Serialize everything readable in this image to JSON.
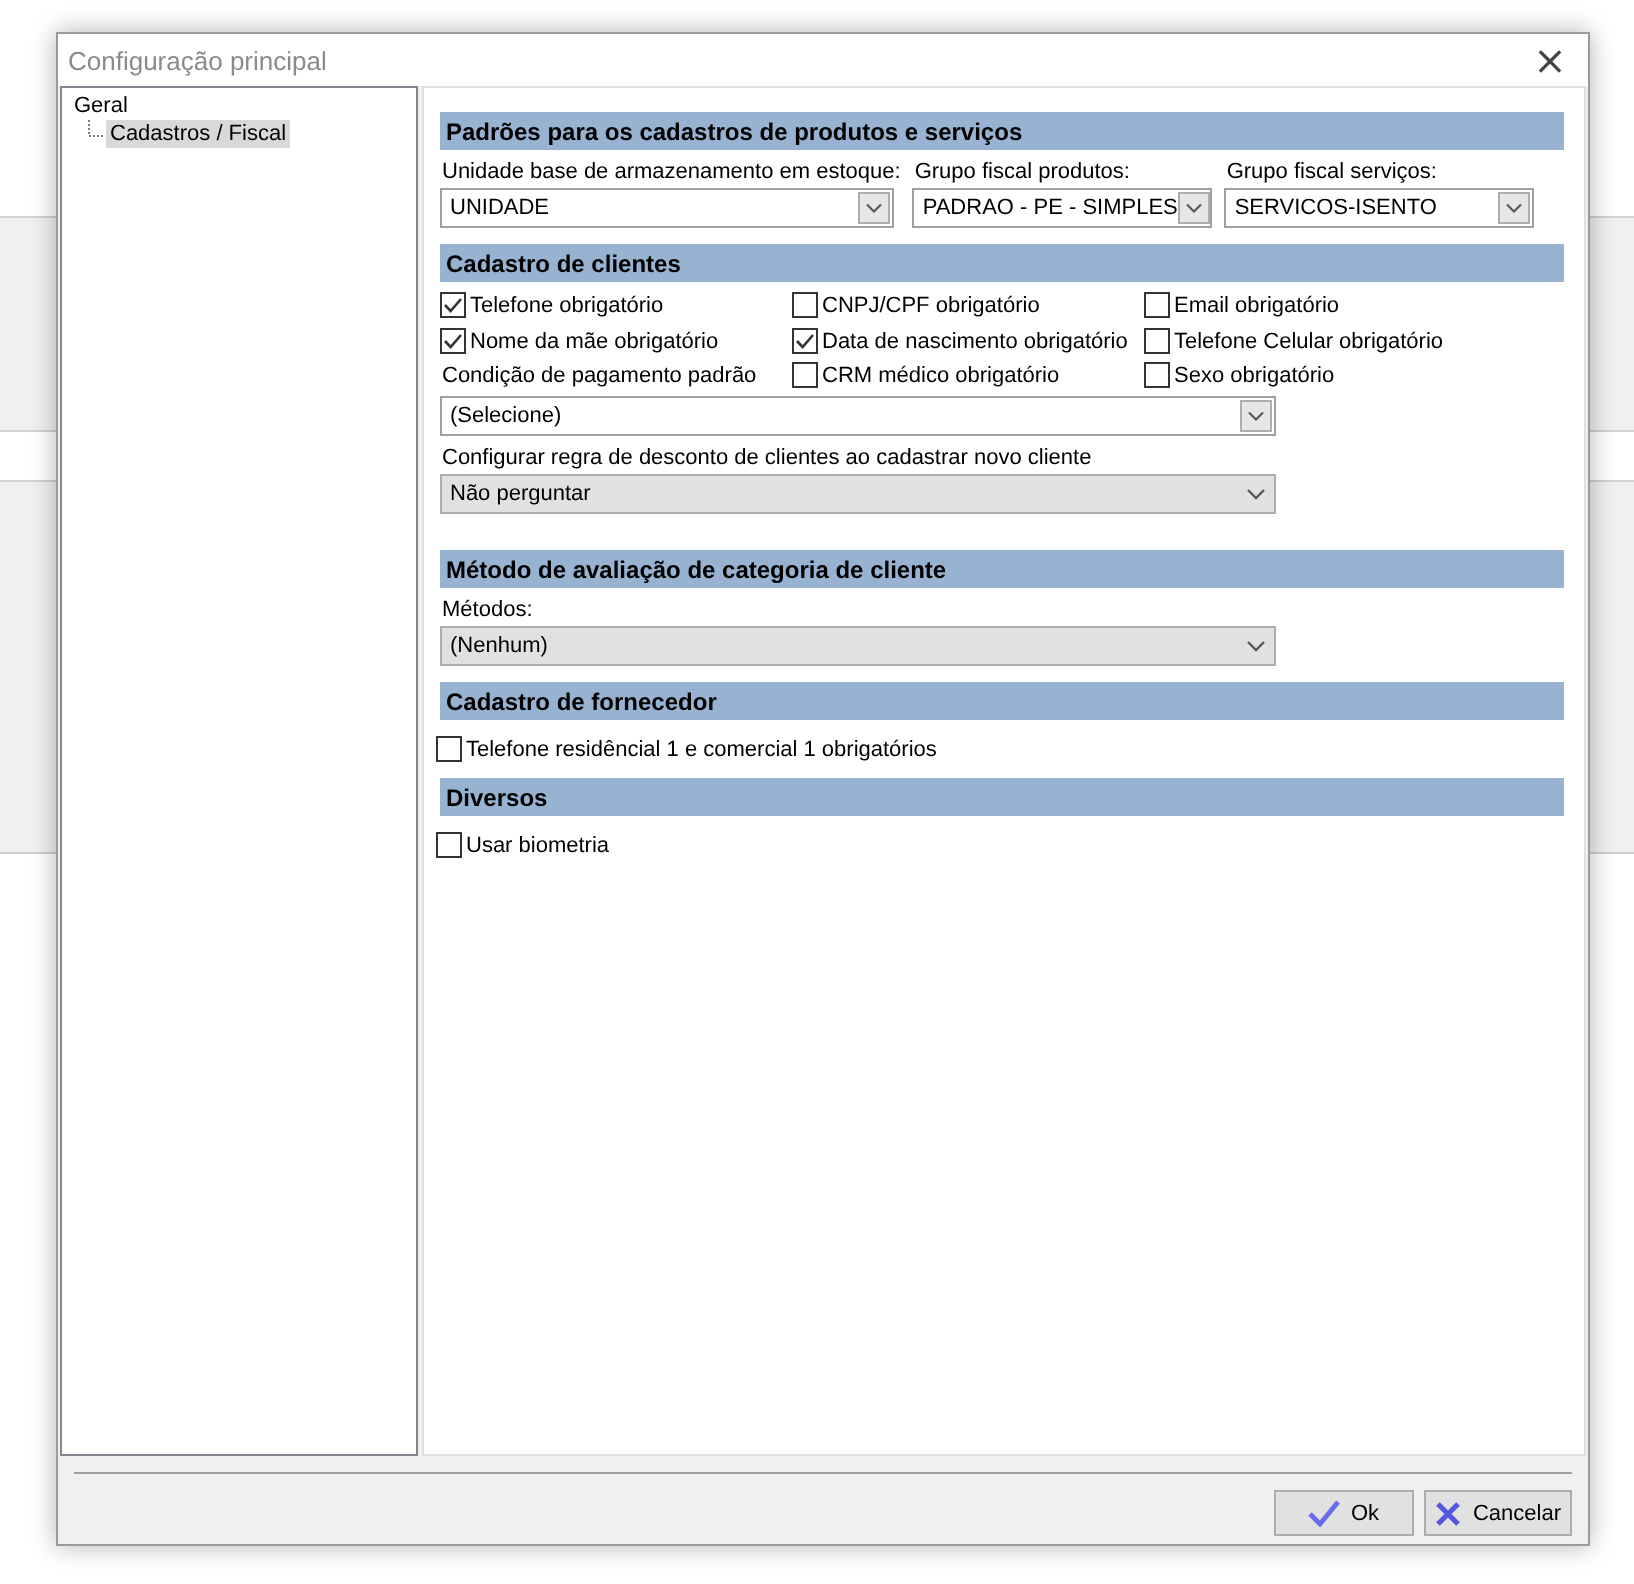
{
  "window": {
    "title": "Configuração principal",
    "close": "×"
  },
  "tree": [
    {
      "label": "Geral",
      "selected": false,
      "children": [
        {
          "label": "Cadastros / Fiscal",
          "selected": true
        }
      ]
    }
  ],
  "sections": [
    {
      "title": "Padrões para os cadastros de produtos e serviços",
      "kind": "combos",
      "combos": [
        {
          "label": "Unidade base de armazenamento em estoque:",
          "value": "UNIDADE",
          "kind": "edit"
        },
        {
          "label": "Grupo fiscal produtos:",
          "value": "PADRAO - PE - SIMPLES",
          "kind": "edit"
        },
        {
          "label": "Grupo fiscal serviços:",
          "value": "SERVICOS-ISENTO",
          "kind": "edit"
        }
      ]
    },
    {
      "title": "Cadastro de clientes",
      "kind": "clients",
      "checks": [
        {
          "label": "Telefone obrigatório",
          "checked": true
        },
        {
          "label": "CNPJ/CPF obrigatório",
          "checked": false
        },
        {
          "label": "Email obrigatório",
          "checked": false
        },
        {
          "label": "Nome da mãe obrigatório",
          "checked": true
        },
        {
          "label": "Data de nascimento obrigatório",
          "checked": true
        },
        {
          "label": "Telefone Celular obrigatório",
          "checked": false
        },
        {
          "label": "CRM médico obrigatório",
          "checked": false
        },
        {
          "label": "Sexo obrigatório",
          "checked": false
        }
      ],
      "combos": [
        {
          "label": "Condição de pagamento padrão",
          "value": "(Selecione)",
          "kind": "edit"
        },
        {
          "label": "Configurar regra de desconto de clientes ao cadastrar novo cliente",
          "value": "Não perguntar",
          "kind": "flat"
        }
      ]
    },
    {
      "title": "Método de avaliação de categoria de cliente",
      "kind": "combos",
      "combos": [
        {
          "label": "Métodos:",
          "value": "(Nenhum)",
          "kind": "flat"
        }
      ]
    },
    {
      "title": "Cadastro de fornecedor",
      "kind": "checks",
      "checks": [
        {
          "label": "Telefone residêncial 1 e comercial 1 obrigatórios",
          "checked": false
        }
      ]
    },
    {
      "title": "Diversos",
      "kind": "checks",
      "checks": [
        {
          "label": "Usar biometria",
          "checked": false
        }
      ]
    }
  ],
  "buttons": [
    {
      "label": "Ok",
      "kind": "ok"
    },
    {
      "label": "Cancelar",
      "kind": "cancel"
    }
  ]
}
